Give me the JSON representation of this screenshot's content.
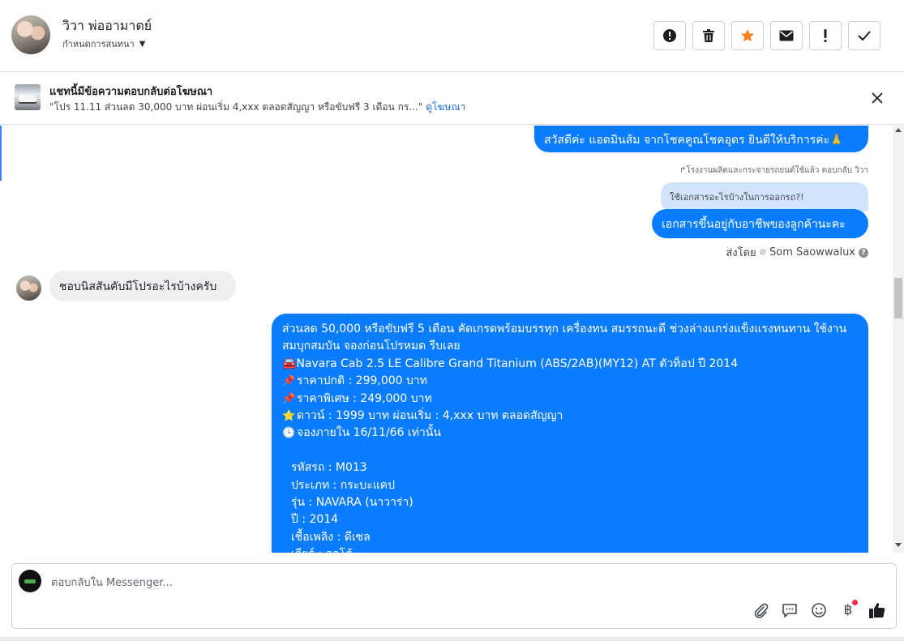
{
  "header": {
    "contact_name": "วิวา พ่ออามาตย์",
    "assign_label": "กำหนดการสนทนา",
    "actions": [
      {
        "icon": "alert-circle-icon",
        "name": "mark-spam-button"
      },
      {
        "icon": "trash-icon",
        "name": "delete-button"
      },
      {
        "icon": "star-icon",
        "name": "star-button"
      },
      {
        "icon": "envelope-icon",
        "name": "mark-unread-button"
      },
      {
        "icon": "exclamation-icon",
        "name": "follow-up-button"
      },
      {
        "icon": "check-icon",
        "name": "mark-done-button"
      }
    ],
    "star_color": "#f5821f"
  },
  "ad_banner": {
    "title": "แชทนี้มีข้อความตอบกลับต่อโฆษณา",
    "text": "\"โปร 11.11 ส่วนลด 30,000 บาท ผ่อนเริ่ม 4,xxx ตลอดสัญญา หรือขับฟรี 3 เดือน กร...\"",
    "link": "ดูโฆษณา"
  },
  "thread": {
    "msg_greeting": "สวัสดีค่ะ แอดมินส้ม จากโชคคูณโชคอุดร ยินดีให้บริการค่ะ🙏",
    "reply_note": "↱โรงงานผลิตและกระจายรถยนต์ใช้แล้ว ตอบกลับ วิวา",
    "quoted_text": "ใช้เอกสารอะไรบ้างในการออกรถ?!",
    "msg_documents": "เอกสารขึ้นอยู่กับอาชีพของลูกค้านะคะ",
    "sent_by_label": "ส่งโดย",
    "sent_by_name": "Som Saowwalux",
    "msg_incoming": "ชอบนิสสันคับมีโปรอะไรบ้างครับ",
    "promo": {
      "intro": "ส่วนลด 50,000 หรือขับฟรี 5 เดือน คัดเกรดพร้อมบรรทุก เครื่องทน สมรรถนะดี ช่วงล่างแกร่งแข็งแรงทนทาน ใช้งานสมบุกสมบัน จองก่อนโปรหมด รีบเลย",
      "model_emoji": "🚘",
      "model": "Navara Cab 2.5 LE Calibre Grand Titanium (ABS/2AB)(MY12) AT ตัวท็อป ปี 2014",
      "pin1": "📌",
      "normal_price": "ราคาปกติ : 299,000 บาท",
      "pin2": "📌",
      "special_price": "ราคาพิเศษ : 249,000 บาท",
      "star": "⭐",
      "down_payment": "ดาวน์ : 1999 บาท ผ่อนเริ่ม : 4,xxx บาท ตลอดสัญญา",
      "clock": "🕓",
      "deadline": "จองภายใน 16/11/66 เท่านั้น",
      "car_code": "รหัสรถ : M013",
      "car_type": "ประเภท : กระบะแคป",
      "car_model": "รุ่น : NAVARA (นาวาร่า)",
      "car_year": "ปี : 2014",
      "fuel": "เชื้อเพลิง : ดีเซล",
      "gear": "เกียร์ : ออโต้"
    }
  },
  "composer": {
    "placeholder": "ตอบกลับใน Messenger...",
    "tools": [
      "paperclip-icon",
      "saved-reply-icon",
      "emoji-icon",
      "baht-icon",
      "thumbs-up-icon"
    ],
    "baht_symbol": "฿"
  },
  "colors": {
    "outgoing_bubble": "#0a7cff",
    "incoming_bubble": "#eeeff1",
    "quoted_bubble": "#d2e4fc",
    "link": "#216fdb"
  }
}
